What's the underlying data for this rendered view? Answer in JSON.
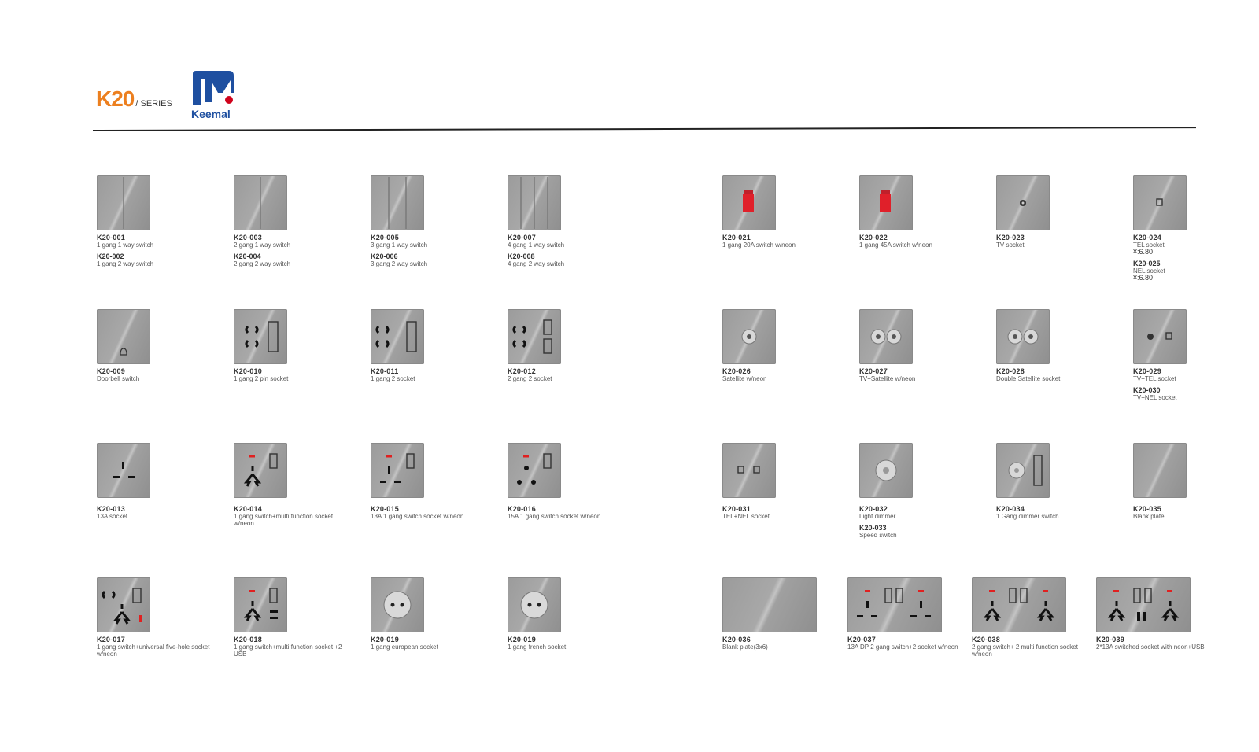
{
  "header": {
    "series_code": "K20",
    "series_suffix": "/ SERIES",
    "brand": "Keemal",
    "colors": {
      "series": "#ec7f1f",
      "brand_blue": "#1e4fa0",
      "brand_red": "#d0021b"
    }
  },
  "products": [
    {
      "id": "p1",
      "code": "K20-001",
      "desc": "1 gang 1 way switch",
      "code2": "K20-002",
      "desc2": "1 gang 2 way switch",
      "icon": "single-rocker-icon"
    },
    {
      "id": "p2",
      "code": "K20-003",
      "desc": "2 gang 1 way switch",
      "code2": "K20-004",
      "desc2": "2 gang 2 way switch",
      "icon": "double-rocker-icon"
    },
    {
      "id": "p3",
      "code": "K20-005",
      "desc": "3 gang 1 way switch",
      "code2": "K20-006",
      "desc2": "3 gang 2 way switch",
      "icon": "triple-rocker-icon"
    },
    {
      "id": "p4",
      "code": "K20-007",
      "desc": "4 gang 1 way switch",
      "code2": "K20-008",
      "desc2": "4 gang 2 way switch",
      "icon": "quad-rocker-icon"
    },
    {
      "id": "p5",
      "code": "K20-021",
      "desc": "1 gang 20A switch w/neon",
      "icon": "red-rocker-icon"
    },
    {
      "id": "p6",
      "code": "K20-022",
      "desc": "1 gang 45A switch w/neon",
      "icon": "red-rocker-icon"
    },
    {
      "id": "p7",
      "code": "K20-023",
      "desc": "TV socket",
      "icon": "tv-socket-icon"
    },
    {
      "id": "p8",
      "code": "K20-024",
      "desc": "TEL socket",
      "price": "¥:6.80",
      "code2": "K20-025",
      "desc2": "NEL socket",
      "price2": "¥:6.80",
      "icon": "tel-socket-icon"
    },
    {
      "id": "p9",
      "code": "K20-009",
      "desc": "Doorbell switch",
      "icon": "bell-icon"
    },
    {
      "id": "p10",
      "code": "K20-010",
      "desc": "1 gang 2 pin socket",
      "icon": "two-pin-socket-icon"
    },
    {
      "id": "p11",
      "code": "K20-011",
      "desc": "1 gang 2 socket",
      "icon": "four-pin-socket-icon"
    },
    {
      "id": "p12",
      "code": "K20-012",
      "desc": "2 gang 2 socket",
      "icon": "four-pin-two-switch-icon"
    },
    {
      "id": "p13",
      "code": "K20-026",
      "desc": "Satellite w/neon",
      "icon": "satellite-socket-icon"
    },
    {
      "id": "p14",
      "code": "K20-027",
      "desc": "TV+Satellite w/neon",
      "icon": "tv-satellite-icon"
    },
    {
      "id": "p15",
      "code": "K20-028",
      "desc": "Double Satellite socket",
      "icon": "double-satellite-icon"
    },
    {
      "id": "p16",
      "code": "K20-029",
      "desc": "TV+TEL socket",
      "code2": "K20-030",
      "desc2": "TV+NEL socket",
      "icon": "tv-tel-icon"
    },
    {
      "id": "p17",
      "code": "K20-013",
      "desc": "13A socket",
      "icon": "uk-socket-icon"
    },
    {
      "id": "p18",
      "code": "K20-014",
      "desc": "1 gang switch+multi function socket w/neon",
      "icon": "multi-socket-icon"
    },
    {
      "id": "p19",
      "code": "K20-015",
      "desc": "13A 1 gang switch socket w/neon",
      "icon": "uk-switch-socket-icon"
    },
    {
      "id": "p20",
      "code": "K20-016",
      "desc": "15A 1 gang switch socket w/neon",
      "icon": "round-pin-socket-icon"
    },
    {
      "id": "p21",
      "code": "K20-031",
      "desc": "TEL+NEL socket",
      "icon": "tel-nel-icon"
    },
    {
      "id": "p22",
      "code": "K20-032",
      "desc": "Light dimmer",
      "code2": "K20-033",
      "desc2": "Speed switch",
      "icon": "dimmer-icon"
    },
    {
      "id": "p23",
      "code": "K20-034",
      "desc": "1 Gang dimmer switch",
      "icon": "dimmer-switch-icon"
    },
    {
      "id": "p24",
      "code": "K20-035",
      "desc": "Blank plate",
      "icon": "blank-plate-icon"
    },
    {
      "id": "p25",
      "code": "K20-017",
      "desc": "1 gang switch+universal five-hole socket w/neon",
      "icon": "universal-socket-icon"
    },
    {
      "id": "p26",
      "code": "K20-018",
      "desc": "1 gang switch+multi function socket +2 USB",
      "icon": "usb-socket-icon"
    },
    {
      "id": "p27",
      "code": "K20-019",
      "desc": "1 gang european socket",
      "icon": "schuko-socket-icon"
    },
    {
      "id": "p28",
      "code": "K20-019",
      "desc": "1 gang french socket",
      "icon": "french-socket-icon"
    },
    {
      "id": "p29",
      "code": "K20-036",
      "desc": "Blank plate(3x6)",
      "icon": "wide-blank-plate-icon"
    },
    {
      "id": "p30",
      "code": "K20-037",
      "desc": "13A DP 2 gang switch+2 socket w/neon",
      "icon": "double-uk-socket-icon"
    },
    {
      "id": "p31",
      "code": "K20-038",
      "desc": "2 gang switch+ 2 multi function socket w/neon",
      "icon": "double-multi-socket-icon"
    },
    {
      "id": "p32",
      "code": "K20-039",
      "desc": "2*13A switched socket with neon+USB",
      "icon": "double-socket-usb-icon"
    }
  ]
}
